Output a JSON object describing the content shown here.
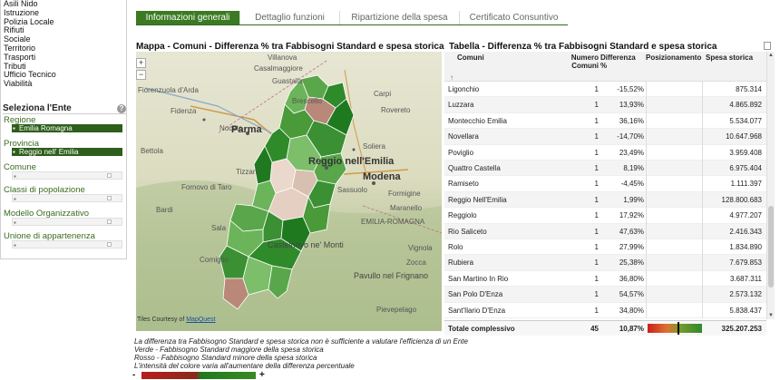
{
  "sidebar": {
    "categories": [
      "Asili Nido",
      "Istruzione",
      "Polizia Locale",
      "Rifiuti",
      "Sociale",
      "Territorio",
      "Trasporti",
      "Tributi",
      "Ufficio Tecnico",
      "Viabilità"
    ],
    "select_title": "Seleziona l'Ente",
    "help_label": "?",
    "filters": {
      "regione_label": "Regione",
      "regione_value": "Emilia Romagna",
      "provincia_label": "Provincia",
      "provincia_value": "Reggio nell' Emilia",
      "comune_label": "Comune",
      "classi_label": "Classi di popolazione",
      "modello_label": "Modello Organizzativo",
      "unione_label": "Unione di appartenenza"
    }
  },
  "tabs": [
    "Informazioni generali",
    "Dettaglio funzioni",
    "Ripartizione della spesa",
    "Certificato Consuntivo"
  ],
  "active_tab": "Informazioni generali",
  "map": {
    "title": "Mappa - Comuni - Differenza % tra Fabbisogni Standard e spesa storica",
    "zoom_in": "+",
    "zoom_out": "−",
    "labels": [
      "Villanova",
      "Casalmaggiore",
      "Fiorenzuola d'Arda",
      "Guastalla",
      "Fidenza",
      "Carpi",
      "Noceto",
      "Parma",
      "Soliera",
      "Rovereto",
      "Reggio nell'Emilia",
      "Modena",
      "Sassuolo",
      "Castelnovo ne' Monti",
      "EMILIA-ROMAGNA",
      "Pavullo nel Frignano",
      "Corniglio",
      "Sala",
      "Pievepelago",
      "Brescello",
      "Fornovo di Taro",
      "Formigine",
      "Maranello",
      "Bettola",
      "Bardi",
      "Tizzano",
      "Vignola",
      "Zocca"
    ],
    "attribution_prefix": "Tiles Courtesy of",
    "attribution_link": "MapQuest"
  },
  "table": {
    "title": "Tabella - Differenza % tra Fabbisogni Standard e spesa storica",
    "columns": {
      "comuni": "Comuni",
      "numero": "Numero Comuni",
      "differenza": "Differenza %",
      "posizionamento": "Posizionamento",
      "spesa": "Spesa storica"
    },
    "sort_indicator": "↑",
    "rows": [
      {
        "name": "Ligonchio",
        "num": "1",
        "diff": "-15,52%",
        "spesa": "875.314"
      },
      {
        "name": "Luzzara",
        "num": "1",
        "diff": "13,93%",
        "spesa": "4.865.892"
      },
      {
        "name": "Montecchio Emilia",
        "num": "1",
        "diff": "36,16%",
        "spesa": "5.534.077"
      },
      {
        "name": "Novellara",
        "num": "1",
        "diff": "-14,70%",
        "spesa": "10.647.968"
      },
      {
        "name": "Poviglio",
        "num": "1",
        "diff": "23,49%",
        "spesa": "3.959.408"
      },
      {
        "name": "Quattro Castella",
        "num": "1",
        "diff": "8,19%",
        "spesa": "6.975.404"
      },
      {
        "name": "Ramiseto",
        "num": "1",
        "diff": "-4,45%",
        "spesa": "1.111.397"
      },
      {
        "name": "Reggio Nell'Emilia",
        "num": "1",
        "diff": "1,99%",
        "spesa": "128.800.683"
      },
      {
        "name": "Reggiolo",
        "num": "1",
        "diff": "17,92%",
        "spesa": "4.977.207"
      },
      {
        "name": "Rio Saliceto",
        "num": "1",
        "diff": "47,63%",
        "spesa": "2.416.343"
      },
      {
        "name": "Rolo",
        "num": "1",
        "diff": "27,99%",
        "spesa": "1.834.890"
      },
      {
        "name": "Rubiera",
        "num": "1",
        "diff": "25,38%",
        "spesa": "7.679.853"
      },
      {
        "name": "San Martino In Rio",
        "num": "1",
        "diff": "36,80%",
        "spesa": "3.687.311"
      },
      {
        "name": "San Polo D'Enza",
        "num": "1",
        "diff": "54,57%",
        "spesa": "2.573.132"
      },
      {
        "name": "Sant'Ilario D'Enza",
        "num": "1",
        "diff": "34,80%",
        "spesa": "5.838.437"
      }
    ],
    "total": {
      "label": "Totale complessivo",
      "num": "45",
      "diff": "10,87%",
      "spesa": "325.207.253"
    }
  },
  "notes": [
    "La differenza tra Fabbisogno Standard e spesa storica non è sufficiente a valutare l'efficienza di un Ente",
    "Verde - Fabbisogno Standard maggiore della spesa storica",
    "Rosso - Fabbisogno Standard minore della spesa storica",
    "L'intensità del colore varia all'aumentare della differenza percentuale"
  ],
  "legend": {
    "minus": "-",
    "plus": "+"
  },
  "colors": {
    "accent": "#3b7a22",
    "positive": "#2e8a2e",
    "negative": "#c8201c"
  }
}
